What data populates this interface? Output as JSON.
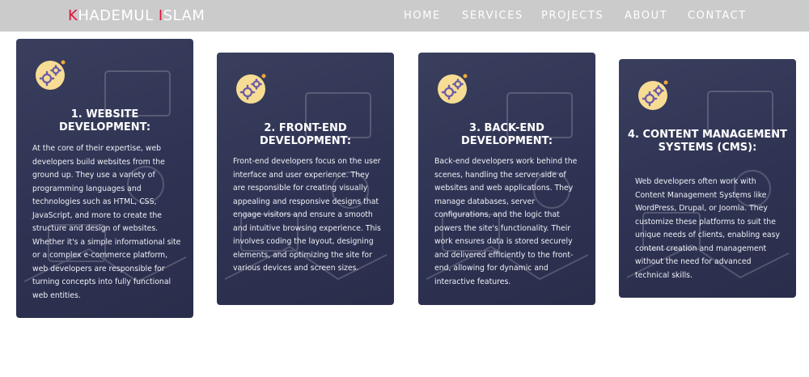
{
  "brand": {
    "first_initial": "K",
    "first_rest": "HADEMUL ",
    "last_initial": "I",
    "last_rest": "SLAM",
    "accent_color": "#e0103a"
  },
  "nav": {
    "items": [
      {
        "label": "HOME"
      },
      {
        "label": "SERVICES"
      },
      {
        "label": "PROJECTS"
      },
      {
        "label": "ABOUT"
      },
      {
        "label": "CONTACT"
      }
    ]
  },
  "cards": [
    {
      "title": "1. WEBSITE DEVELOPMENT:",
      "body": "At the core of their expertise, web developers build websites from the ground up. They use a variety of programming languages and technologies such as HTML, CSS, JavaScript, and more to create the structure and design of websites. Whether it's a simple informational site or a complex e-commerce platform, web developers are responsible for turning concepts into fully functional web entities.",
      "icon": "gears-icon"
    },
    {
      "title": "2. FRONT-END DEVELOPMENT:",
      "body": "Front-end developers focus on the user interface and user experience. They are responsible for creating visually appealing and responsive designs that engage visitors and ensure a smooth and intuitive browsing experience. This involves coding the layout, designing elements, and optimizing the site for various devices and screen sizes.",
      "icon": "gears-icon"
    },
    {
      "title": "3. BACK-END DEVELOPMENT:",
      "body": "Back-end developers work behind the scenes, handling the server-side of websites and web applications. They manage databases, server configurations, and the logic that powers the site's functionality. Their work ensures data is stored securely and delivered efficiently to the front-end, allowing for dynamic and interactive features.",
      "icon": "gears-icon"
    },
    {
      "title": "4. CONTENT MANAGEMENT SYSTEMS (CMS):",
      "body": "Web developers often work with Content Management Systems like WordPress, Drupal, or Joomla. They customize these platforms to suit the unique needs of clients, enabling easy content creation and management without the need for advanced technical skills.",
      "icon": "gears-icon"
    }
  ],
  "colors": {
    "card_bg": "#2f3353",
    "nav_bg": "#cbcbcb",
    "icon_bg": "#f7dc94"
  }
}
